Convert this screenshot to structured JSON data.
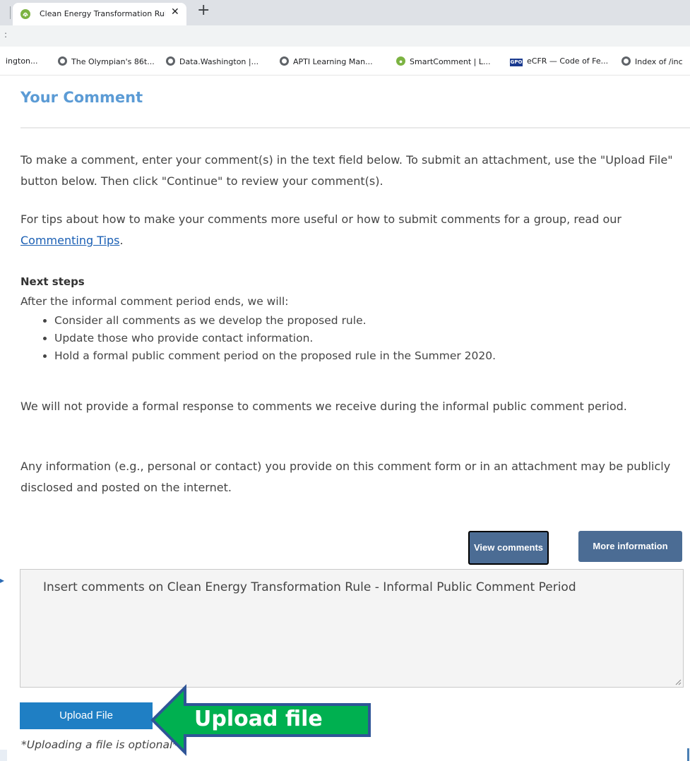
{
  "browser": {
    "tab_title": "Clean Energy Transformation Rul",
    "tab_close": "✕",
    "new_tab": "+",
    "address_dots": ":",
    "bookmarks": [
      {
        "label": "ington...",
        "icon": "none"
      },
      {
        "label": "The Olympian's 86t...",
        "icon": "globe-icon"
      },
      {
        "label": "Data.Washington |...",
        "icon": "globe-icon"
      },
      {
        "label": "APTI Learning Man...",
        "icon": "globe-icon"
      },
      {
        "label": "SmartComment | L...",
        "icon": "smartcomment-icon"
      },
      {
        "label": "eCFR — Code of Fe...",
        "icon": "gpo-icon"
      },
      {
        "label": "Index of /inc",
        "icon": "globe-icon"
      }
    ],
    "gpo_badge": "GPO"
  },
  "page": {
    "heading": "Your Comment",
    "intro": "To make a comment, enter your comment(s) in the text field below. To submit an attachment, use the \"Upload File\" button below. Then click \"Continue\" to review your comment(s).",
    "tips_before": "For tips about how to make your comments more useful or how to submit comments for a group, read our ",
    "tips_link": "Commenting Tips",
    "tips_after": ".",
    "next_steps_title": "Next steps",
    "next_steps_intro": "After the informal comment period ends, we will:",
    "next_steps": [
      "Consider all comments as we develop the proposed rule.",
      "Update those who provide contact information.",
      "Hold a formal public comment period on the proposed rule in the Summer 2020."
    ],
    "no_response": "We will not provide a formal response to comments we receive during the informal public comment period.",
    "disclosure": "Any information (e.g., personal or contact) you provide on this comment form or in an attachment may be publicly disclosed and posted on the internet.",
    "view_comments_label": "View comments",
    "more_info_label": "More information",
    "comment_placeholder": "Insert comments on Clean Energy Transformation Rule - Informal Public Comment Period",
    "upload_label": "Upload File",
    "upload_note": "*Uploading a file is optional*"
  },
  "annotation": {
    "callout_text": "Upload file",
    "arrow_fill": "#00b050",
    "arrow_stroke": "#2f5597"
  },
  "colors": {
    "heading": "#5b9bd5",
    "button": "#4b6c94",
    "upload_button": "#1f7fc4",
    "link": "#1a5fb4"
  }
}
